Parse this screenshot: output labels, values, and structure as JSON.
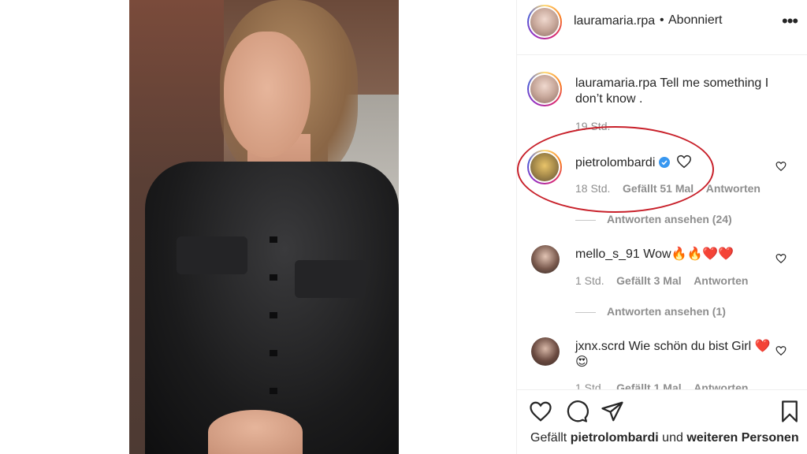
{
  "post": {
    "username": "lauramaria.rpa",
    "follow_status": "Abonniert",
    "separator": "•",
    "more_label": "•••"
  },
  "caption": {
    "username": "lauramaria.rpa",
    "text": "Tell me something I don’t know .",
    "time": "19 Std."
  },
  "comments": [
    {
      "username": "pietrolombardi",
      "verified": true,
      "text": "",
      "time": "18 Std.",
      "likes": "Gefällt 51 Mal",
      "reply": "Antworten",
      "view_replies": "Antworten ansehen (24)"
    },
    {
      "username": "mello_s_91",
      "text": "Wow🔥🔥❤️❤️",
      "time": "1 Std.",
      "likes": "Gefällt 3 Mal",
      "reply": "Antworten",
      "view_replies": "Antworten ansehen (1)"
    },
    {
      "username": "jxnx.scrd",
      "text": "Wie schön du bist Girl",
      "emojis": "❤️😍",
      "time": "1 Std.",
      "likes": "Gefällt 1 Mal",
      "reply": "Antworten"
    }
  ],
  "footer": {
    "likes_prefix": "Gefällt",
    "likes_user": "pietrolombardi",
    "likes_connector": "und",
    "likes_suffix": "weiteren Personen"
  },
  "colors": {
    "annotation": "#c8202a",
    "verified": "#3897f0",
    "text": "#262626",
    "muted": "#8e8e8e"
  },
  "icons": [
    "more-options-icon",
    "heart-icon",
    "comment-icon",
    "share-icon",
    "bookmark-icon",
    "verified-badge-icon"
  ]
}
